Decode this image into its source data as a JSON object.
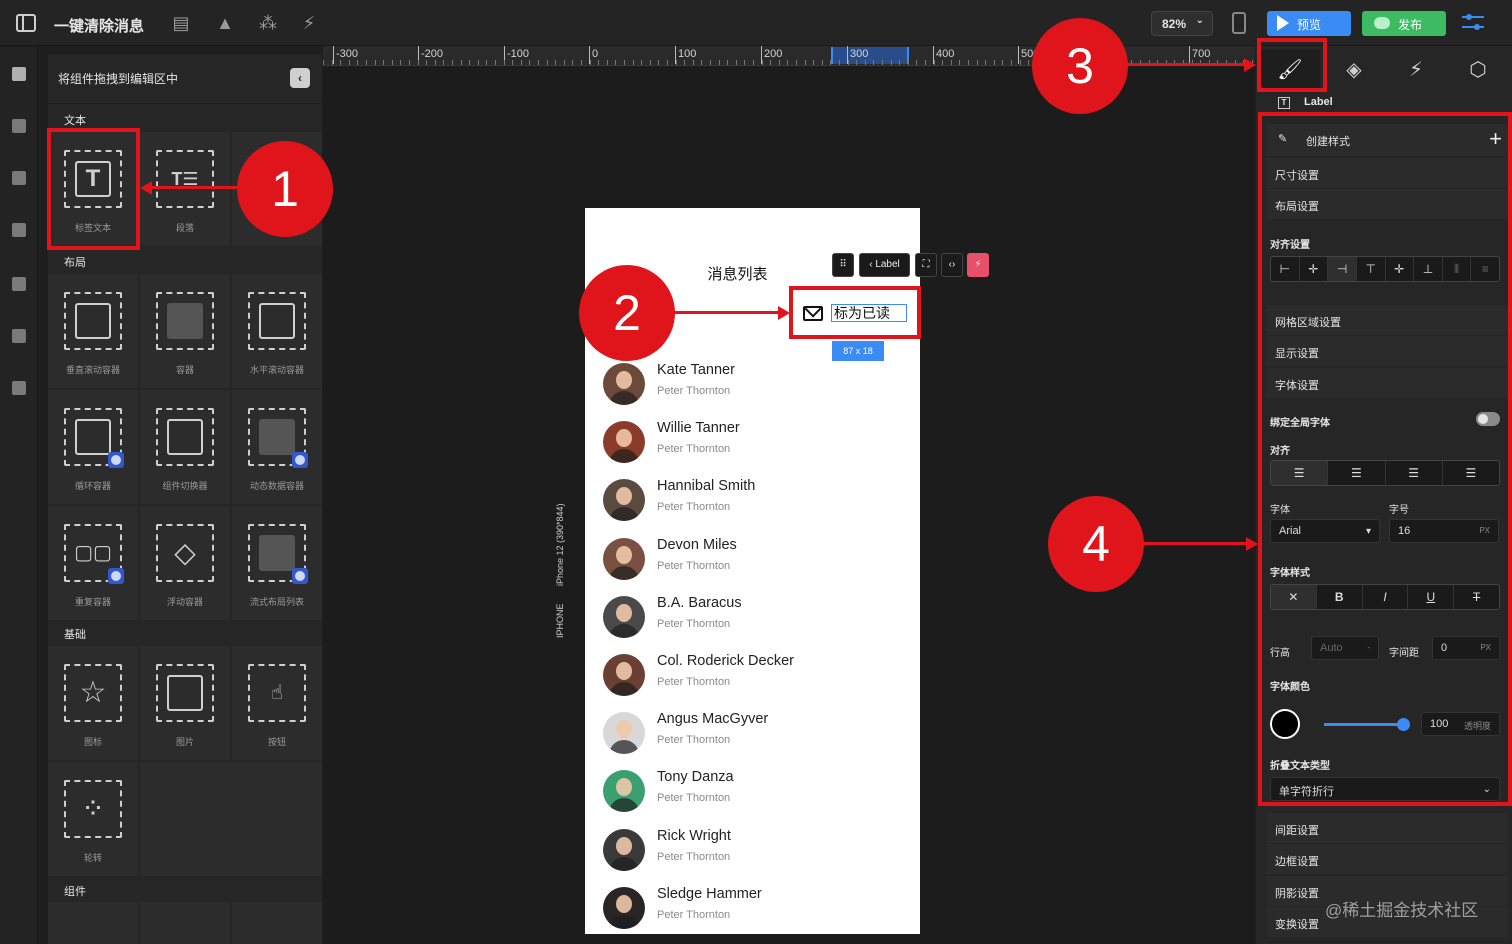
{
  "app": {
    "title": "一键清除消息"
  },
  "topbar": {
    "zoom": "82%",
    "preview_label": "预览",
    "publish_label": "发布",
    "colors": {
      "preview": "#3b8bf5",
      "publish": "#3dbb63"
    }
  },
  "panel": {
    "header": "将组件拖拽到编辑区中",
    "sections": {
      "text": "文本",
      "layout": "布局",
      "basic": "基础",
      "components": "组件"
    },
    "tiles": [
      {
        "label": "标签文本",
        "icon": "text-label-icon"
      },
      {
        "label": "段落",
        "icon": "paragraph-icon"
      },
      {
        "label": "垂直滚动容器",
        "icon": "vertical-scroll-icon"
      },
      {
        "label": "容器",
        "icon": "container-icon"
      },
      {
        "label": "水平滚动容器",
        "icon": "horizontal-scroll-icon"
      },
      {
        "label": "循环容器",
        "icon": "loop-container-icon"
      },
      {
        "label": "组件切换器",
        "icon": "component-switcher-icon"
      },
      {
        "label": "动态数据容器",
        "icon": "dynamic-data-icon"
      },
      {
        "label": "重复容器",
        "icon": "repeat-container-icon"
      },
      {
        "label": "浮动容器",
        "icon": "floating-container-icon"
      },
      {
        "label": "流式布局列表",
        "icon": "flow-layout-icon"
      },
      {
        "label": "图标",
        "icon": "star-icon"
      },
      {
        "label": "图片",
        "icon": "image-icon"
      },
      {
        "label": "按钮",
        "icon": "button-icon"
      },
      {
        "label": "轮转",
        "icon": "carousel-icon"
      }
    ]
  },
  "ruler": {
    "labels": [
      "-300",
      "-200",
      "-100",
      "0",
      "100",
      "200",
      "300",
      "400",
      "500",
      "700"
    ]
  },
  "device": {
    "name": "IPHONE",
    "model": "iPhone 12 (390*844)"
  },
  "phone": {
    "title": "消息列表",
    "mark_read": "标为已读",
    "selection_size": "87 x 18",
    "contacts": [
      {
        "name": "Kate Tanner",
        "sub": "Peter Thornton"
      },
      {
        "name": "Willie Tanner",
        "sub": "Peter Thornton"
      },
      {
        "name": "Hannibal Smith",
        "sub": "Peter Thornton"
      },
      {
        "name": "Devon Miles",
        "sub": "Peter Thornton"
      },
      {
        "name": "B.A. Baracus",
        "sub": "Peter Thornton"
      },
      {
        "name": "Col. Roderick Decker",
        "sub": "Peter Thornton"
      },
      {
        "name": "Angus MacGyver",
        "sub": "Peter Thornton"
      },
      {
        "name": "Tony Danza",
        "sub": "Peter Thornton"
      },
      {
        "name": "Rick Wright",
        "sub": "Peter Thornton"
      },
      {
        "name": "Sledge Hammer",
        "sub": "Peter Thornton"
      }
    ]
  },
  "float_toolbar": {
    "label": "Label"
  },
  "right": {
    "layer_label": "Label",
    "create_style": "创建样式",
    "rows": {
      "size": "尺寸设置",
      "layout": "布局设置",
      "grid": "网格区域设置",
      "display": "显示设置",
      "font": "字体设置",
      "spacing": "间距设置",
      "border": "边框设置",
      "shadow": "阴影设置",
      "transform": "变换设置"
    },
    "align_section": "对齐设置",
    "bind_global_font": "绑定全局字体",
    "align": "对齐",
    "font_family_label": "字体",
    "font_family": "Arial",
    "font_size_label": "字号",
    "font_size": "16",
    "unit": "PX",
    "font_style": "字体样式",
    "style_bold": "B",
    "style_italic": "I",
    "style_underline": "U",
    "line_height_label": "行高",
    "line_height": "Auto",
    "line_height_suffix": "-",
    "letter_spacing_label": "字间距",
    "letter_spacing": "0",
    "font_color": "字体颜色",
    "opacity": "100",
    "opacity_label": "透明度",
    "opacity_level": 1.0,
    "wrap_type_label": "折叠文本类型",
    "wrap_type": "单字符折行"
  },
  "annotations": [
    "1",
    "2",
    "3",
    "4"
  ],
  "watermark": "@稀土掘金技术社区"
}
